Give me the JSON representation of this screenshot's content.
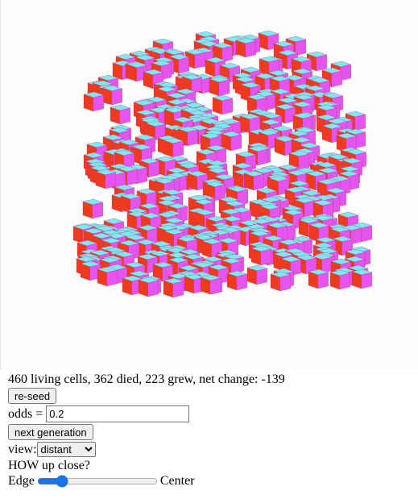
{
  "status": {
    "text": "460 living cells, 362 died, 223 grew, net change: -139"
  },
  "buttons": {
    "reseed": "re-seed",
    "next_generation": "next generation"
  },
  "odds": {
    "label": "odds =",
    "value": "0.2"
  },
  "view": {
    "label": "view:",
    "selected": "distant"
  },
  "closeness": {
    "question": "HOW up close?",
    "left_label": "Edge",
    "right_label": "Center",
    "value_fraction": 0.17
  },
  "colors": {
    "cube_top": "#7ee8f0",
    "cube_left": "#ee3a1e",
    "cube_right": "#e554ef",
    "canvas_bg": "#fcfcfc"
  }
}
